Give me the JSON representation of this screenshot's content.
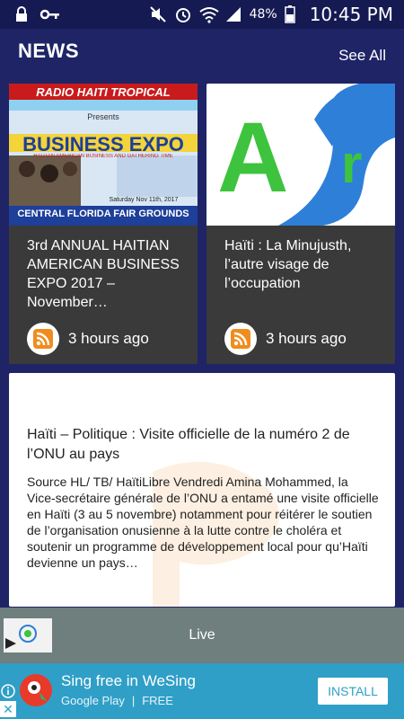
{
  "status_bar": {
    "time": "10:45 PM",
    "battery": "48%",
    "icons": [
      "lock-icon",
      "key-icon",
      "mute-icon",
      "alarm-icon",
      "wifi-icon",
      "signal-icon",
      "battery-icon"
    ]
  },
  "header": {
    "title": "NEWS",
    "see_all": "See All"
  },
  "cards": [
    {
      "thumb_text": {
        "station": "RADIO HAITI TROPICAL",
        "presents": "Presents",
        "event": "BUSINESS EXPO",
        "tagline": "HAITIAN AMERICAN BUSINESS AND GATHERING TIME",
        "date": "Saturday Nov 11th, 2017",
        "venue": "CENTRAL FLORIDA FAIR GROUNDS"
      },
      "title": "3rd ANNUAL HAITIAN AMERICAN BUSINESS EXPO 2017 – November…",
      "time": "3 hours ago"
    },
    {
      "title": "Haïti : La Minujusth, l’autre visage de l’occupation",
      "time": "3 hours ago"
    }
  ],
  "feature": {
    "title": "Haïti – Politique : Visite officielle de la numéro 2 de l’ONU au pays",
    "body": "Source HL/ TB/ HaïtiLibre     Vendredi Amina Mohammed, la Vice-secrétaire générale de l’ONU a entamé une visite officielle en Haïti (3 au 5 novembre) notamment pour réitérer le soutien de l’organisation onusienne à la lutte contre le choléra et soutenir un programme de développement local pour qu’Haïti devienne un pays…"
  },
  "live": {
    "label": "Live"
  },
  "ad": {
    "headline": "Sing free in WeSing",
    "store": "Google Play",
    "price": "FREE",
    "cta": "INSTALL"
  }
}
